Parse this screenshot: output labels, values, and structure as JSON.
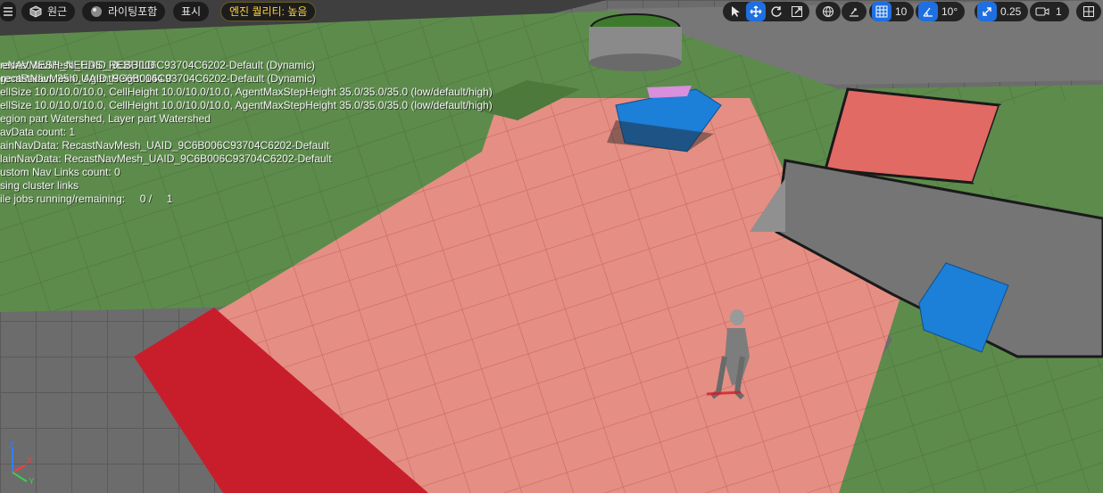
{
  "toolbar": {
    "menu_icon": "hamburger-icon",
    "perspective_label": "원근",
    "lighting_label": "라이팅포함",
    "show_label": "표시",
    "quality_label": "엔진 퀄리티: 높음",
    "grid_snap_value": "10",
    "rotation_snap_value": "10°",
    "scale_snap_value": "0.25",
    "camera_speed_value": "1"
  },
  "stats": {
    "line1a": "recastNavMesh_UAID_9C6B006C93704C6202-Default (Dynamic)",
    "line1b": "eNAVMESH_NEEDS_REBUILD",
    "line2a": "gentRadius 35.0, AgentHeight 144.0",
    "line2b": "recastNavMesh_UAID_9C6B006C93704C6202-Default (Dynamic)",
    "line3a": "ellSize 10.0/10.0/10.0, CellHeight 10.0/10.0/10.0, AgentMaxStepHeight 35.0/35.0/35.0 (low/default/high)",
    "line4a": "ellSize 10.0/10.0/10.0, CellHeight 10.0/10.0/10.0, AgentMaxStepHeight 35.0/35.0/35.0 (low/default/high)",
    "line5": "egion part Watershed, Layer part Watershed",
    "line6": "avData count: 1",
    "line7a": "ainNavData: RecastNavMesh_UAID_9C6B006C93704C6202-Default",
    "line8a": "lainNavData: RecastNavMesh_UAID_9C6B006C93704C6202-Default",
    "line9a": "ustom Nav Links count: 0",
    "line10": "sing cluster links",
    "line11": "ile jobs running/remaining:     0 /     1"
  },
  "colors": {
    "walkable_red": "#e38a80",
    "walkable_green": "#5a8a4a",
    "accent_blue": "#1f6fe0",
    "cube_blue": "#1c7fd8",
    "quality_yellow": "#ffd23a"
  }
}
